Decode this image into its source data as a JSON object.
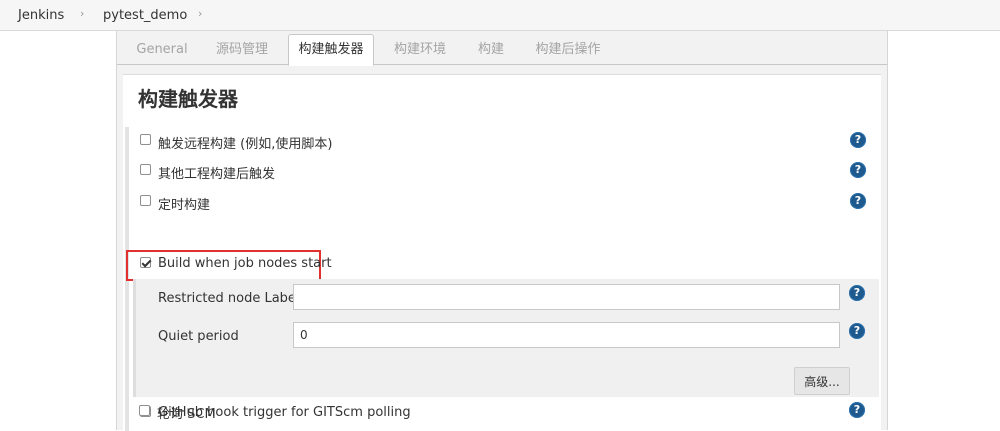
{
  "breadcrumb": {
    "items": [
      "Jenkins",
      "pytest_demo"
    ]
  },
  "tabs": [
    {
      "label": "General",
      "active": false
    },
    {
      "label": "源码管理",
      "active": false
    },
    {
      "label": "构建触发器",
      "active": true
    },
    {
      "label": "构建环境",
      "active": false
    },
    {
      "label": "构建",
      "active": false
    },
    {
      "label": "构建后操作",
      "active": false
    }
  ],
  "section": {
    "title": "构建触发器"
  },
  "triggers": [
    {
      "label": "触发远程构建 (例如,使用脚本)",
      "checked": false
    },
    {
      "label": "其他工程构建后触发",
      "checked": false
    },
    {
      "label": "定时构建",
      "checked": false
    },
    {
      "label": "Build when job nodes start",
      "checked": true
    },
    {
      "label": "GitHub hook trigger for GITScm polling",
      "checked": false
    },
    {
      "label": "轮询 SCM",
      "checked": false
    }
  ],
  "node_start": {
    "restricted_label": "Restricted node Label",
    "restricted_value": "",
    "quiet_label": "Quiet period",
    "quiet_value": "0",
    "advanced_label": "高级..."
  },
  "help_glyph": "?",
  "colors": {
    "highlight": "#e0312f",
    "help_icon": "#1e5a8e",
    "panel_bg": "#f2f2f2"
  }
}
